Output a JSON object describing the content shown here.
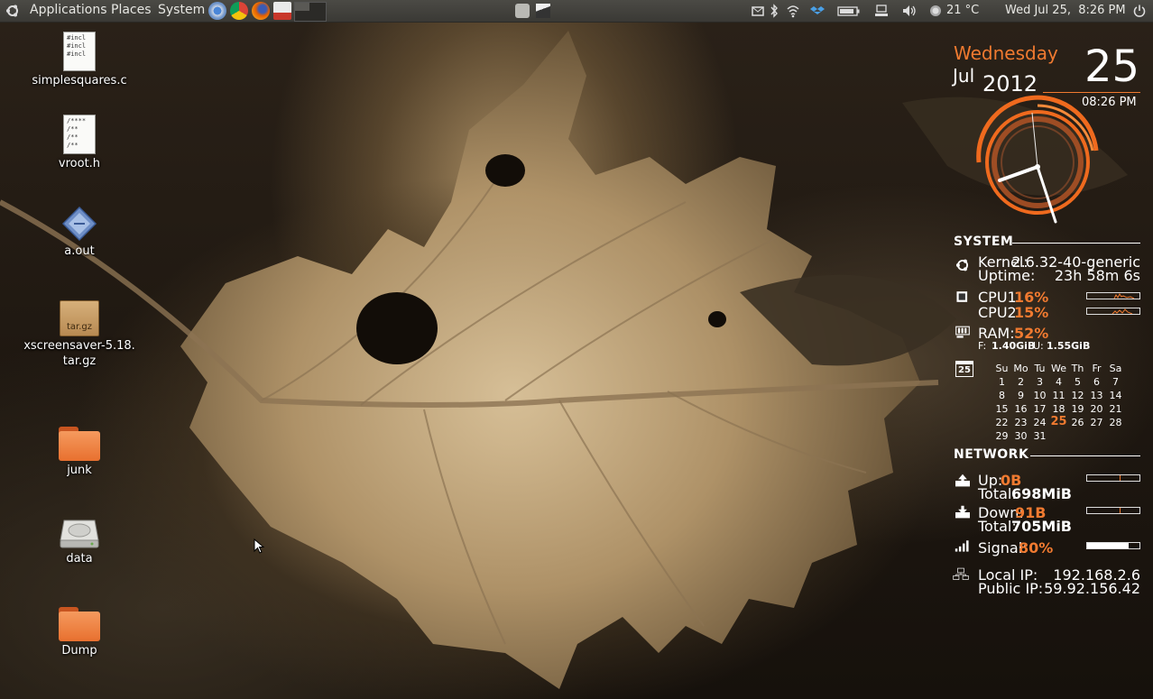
{
  "panel": {
    "menus": [
      "Applications",
      "Places",
      "System"
    ],
    "weather": "21 °C",
    "datetime": "Wed Jul 25,  8:26 PM"
  },
  "desktop_icons": [
    {
      "label": "simplesquares.c",
      "preview": [
        "#incl",
        "#incl",
        "",
        "#incl"
      ]
    },
    {
      "label": "vroot.h",
      "preview": [
        "/****",
        "/**",
        "/**",
        "/**"
      ]
    },
    {
      "label": "a.out"
    },
    {
      "label": "xscreensaver-5.18.",
      "label2": "tar.gz",
      "badge": "tar.gz"
    },
    {
      "label": "junk"
    },
    {
      "label": "data"
    },
    {
      "label": "Dump"
    }
  ],
  "clock": {
    "weekday": "Wednesday",
    "month": "Jul",
    "year": "2012",
    "day": "25",
    "time": "08:26 PM"
  },
  "system": {
    "heading": "SYSTEM",
    "kernel_label": "Kernel:",
    "kernel_value": "2.6.32-40-generic",
    "uptime_label": "Uptime:",
    "uptime_value": "23h 58m 6s",
    "cpu1_label": "CPU1:",
    "cpu1_value": "16%",
    "cpu2_label": "CPU2:",
    "cpu2_value": "15%",
    "ram_label": "RAM:",
    "ram_value": "52%",
    "ram_free_label": "F:",
    "ram_free_value": "1.40GiB",
    "ram_used_label": "U:",
    "ram_used_value": "1.55GiB",
    "cal_icon_day": "25"
  },
  "calendar": {
    "weekdays": [
      "Su",
      "Mo",
      "Tu",
      "We",
      "Th",
      "Fr",
      "Sa"
    ],
    "weeks": [
      [
        "1",
        "2",
        "3",
        "4",
        "5",
        "6",
        "7"
      ],
      [
        "8",
        "9",
        "10",
        "11",
        "12",
        "13",
        "14"
      ],
      [
        "15",
        "16",
        "17",
        "18",
        "19",
        "20",
        "21"
      ],
      [
        "22",
        "23",
        "24",
        "25",
        "26",
        "27",
        "28"
      ],
      [
        "29",
        "30",
        "31",
        "",
        "",
        "",
        ""
      ]
    ],
    "today": "25"
  },
  "network": {
    "heading": "NETWORK",
    "up_label": "Up:",
    "up_value": "0B",
    "up_total_label": "Total:",
    "up_total_value": "698MiB",
    "down_label": "Down:",
    "down_value": "91B",
    "down_total_label": "Total:",
    "down_total_value": "705MiB",
    "signal_label": "Signal:",
    "signal_value": "80%",
    "signal_level": 0.8,
    "local_ip_label": "Local IP:",
    "local_ip_value": "192.168.2.6",
    "public_ip_label": "Public IP:",
    "public_ip_value": "59.92.156.42"
  },
  "colors": {
    "accent": "#f07a30",
    "panel": "#3c3b37"
  }
}
